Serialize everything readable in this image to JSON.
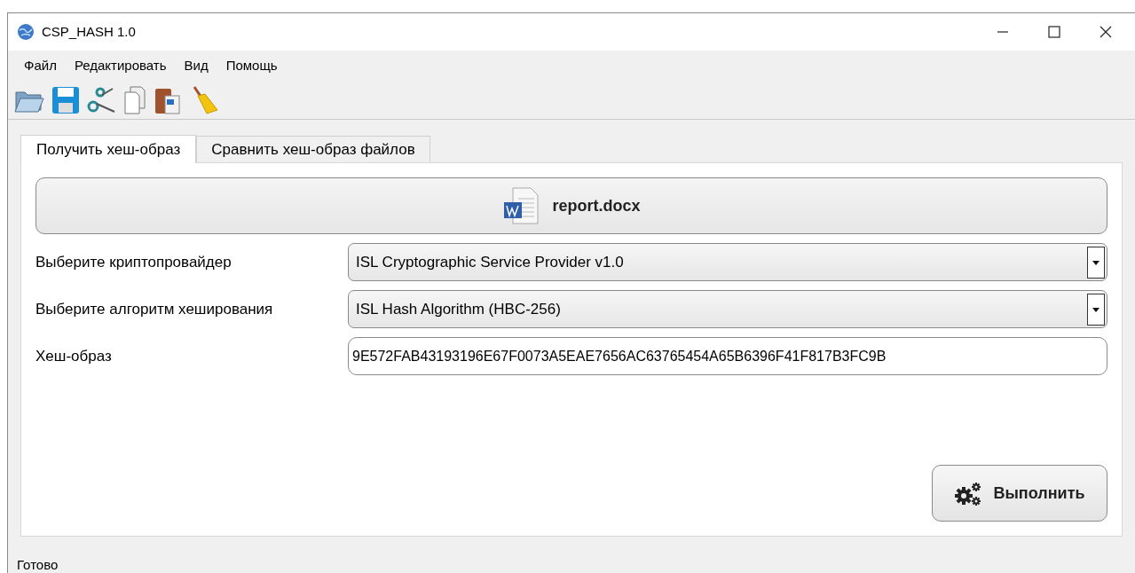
{
  "window": {
    "title": "CSP_HASH 1.0"
  },
  "menu": [
    "Файл",
    "Редактировать",
    "Вид",
    "Помощь"
  ],
  "tabs": [
    {
      "label": "Получить хеш-образ",
      "selected": true
    },
    {
      "label": "Сравнить хеш-образ файлов",
      "selected": false
    }
  ],
  "file_button": {
    "label": "report.docx"
  },
  "fields": [
    {
      "kind": "select",
      "label": "Выберите криптопровайдер",
      "value": "ISL Cryptographic Service Provider v1.0"
    },
    {
      "kind": "select",
      "label": "Выберите алгоритм хеширования",
      "value": "ISL Hash Algorithm (HBC-256)"
    },
    {
      "kind": "input",
      "label": "Хеш-образ",
      "value": "9E572FAB43193196E67F0073A5EAE7656AC63765454A65B6396F41F817B3FC9B"
    }
  ],
  "run_button": {
    "label": "Выполнить"
  },
  "status_bar": "Готово"
}
